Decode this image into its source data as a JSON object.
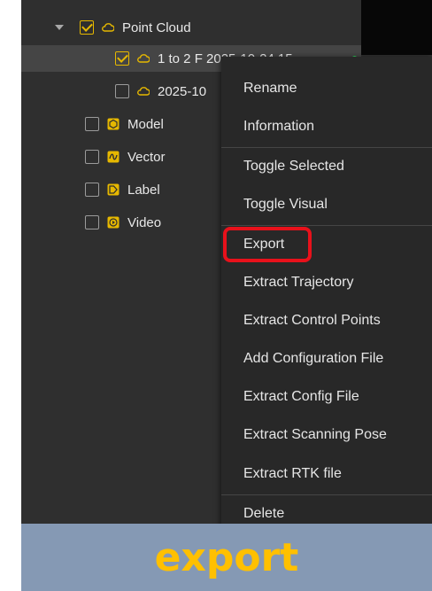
{
  "tree": {
    "point_cloud": {
      "label": "Point Cloud",
      "checked": true,
      "icon": "cloud-icon"
    },
    "children": [
      {
        "label": "1 to 2 F 2025-10-24 15",
        "checked": true,
        "icon": "cloud-icon"
      },
      {
        "label": "2025-10",
        "checked": false,
        "icon": "cloud-icon"
      }
    ],
    "model": {
      "label": "Model",
      "checked": false,
      "icon": "model-icon"
    },
    "vector": {
      "label": "Vector",
      "checked": false,
      "icon": "vector-icon"
    },
    "label": {
      "label": "Label",
      "checked": false,
      "icon": "tag-icon"
    },
    "video": {
      "label": "Video",
      "checked": false,
      "icon": "video-icon"
    }
  },
  "context_menu": {
    "items": [
      "Rename",
      "Information",
      "Toggle Selected",
      "Toggle Visual",
      "Export",
      "Extract Trajectory",
      "Extract Control Points",
      "Add Configuration File",
      "Extract Config File",
      "Extract Scanning Pose",
      "Extract RTK file",
      "Delete"
    ]
  },
  "banner": {
    "text": "export"
  },
  "colors": {
    "accent": "#e6b800",
    "highlight_border": "#e8111b",
    "banner_bg": "#8599b4",
    "banner_text": "#ffc000",
    "status_dot": "#2ed15a"
  }
}
